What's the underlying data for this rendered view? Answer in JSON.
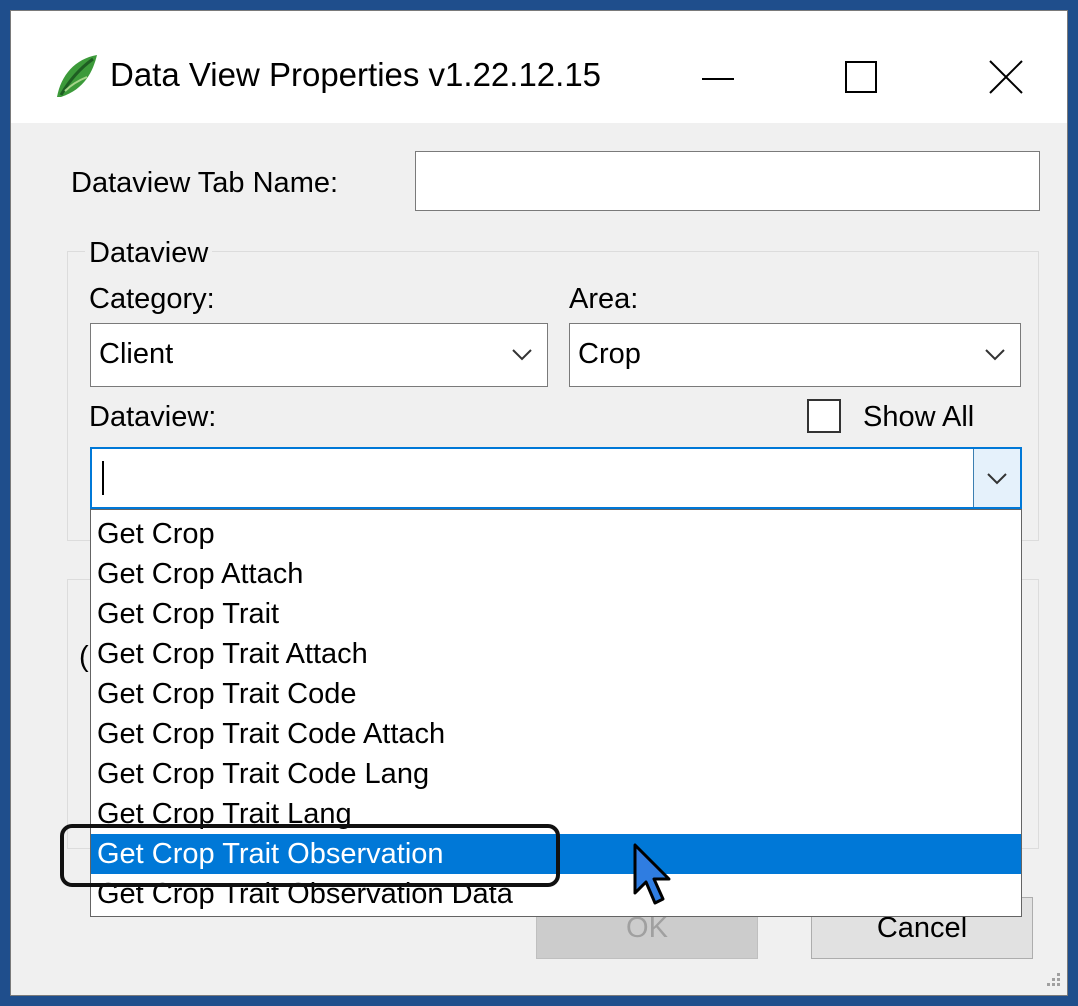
{
  "window": {
    "title": "Data View Properties v1.22.12.15"
  },
  "form": {
    "tab_name_label": "Dataview Tab Name:",
    "tab_name_value": "",
    "group_title": "Dataview",
    "category_label": "Category:",
    "category_value": "Client",
    "area_label": "Area:",
    "area_value": "Crop",
    "dataview_label": "Dataview:",
    "show_all_label": "Show All",
    "show_all_checked": false,
    "dataview_value": ""
  },
  "dropdown": {
    "items": [
      "Get Crop",
      "Get Crop Attach",
      "Get Crop Trait",
      "Get Crop Trait Attach",
      "Get Crop Trait Code",
      "Get Crop Trait Code Attach",
      "Get Crop Trait Code Lang",
      "Get Crop Trait Lang",
      "Get Crop Trait Observation",
      "Get Crop Trait Observation Data"
    ],
    "selected_index": 8
  },
  "buttons": {
    "ok_label": "OK",
    "cancel_label": "Cancel"
  },
  "colors": {
    "selection": "#0078d7",
    "background": "#1f4e8c"
  },
  "icons": {
    "app": "leaf-icon",
    "cursor": "mouse-pointer-icon"
  }
}
